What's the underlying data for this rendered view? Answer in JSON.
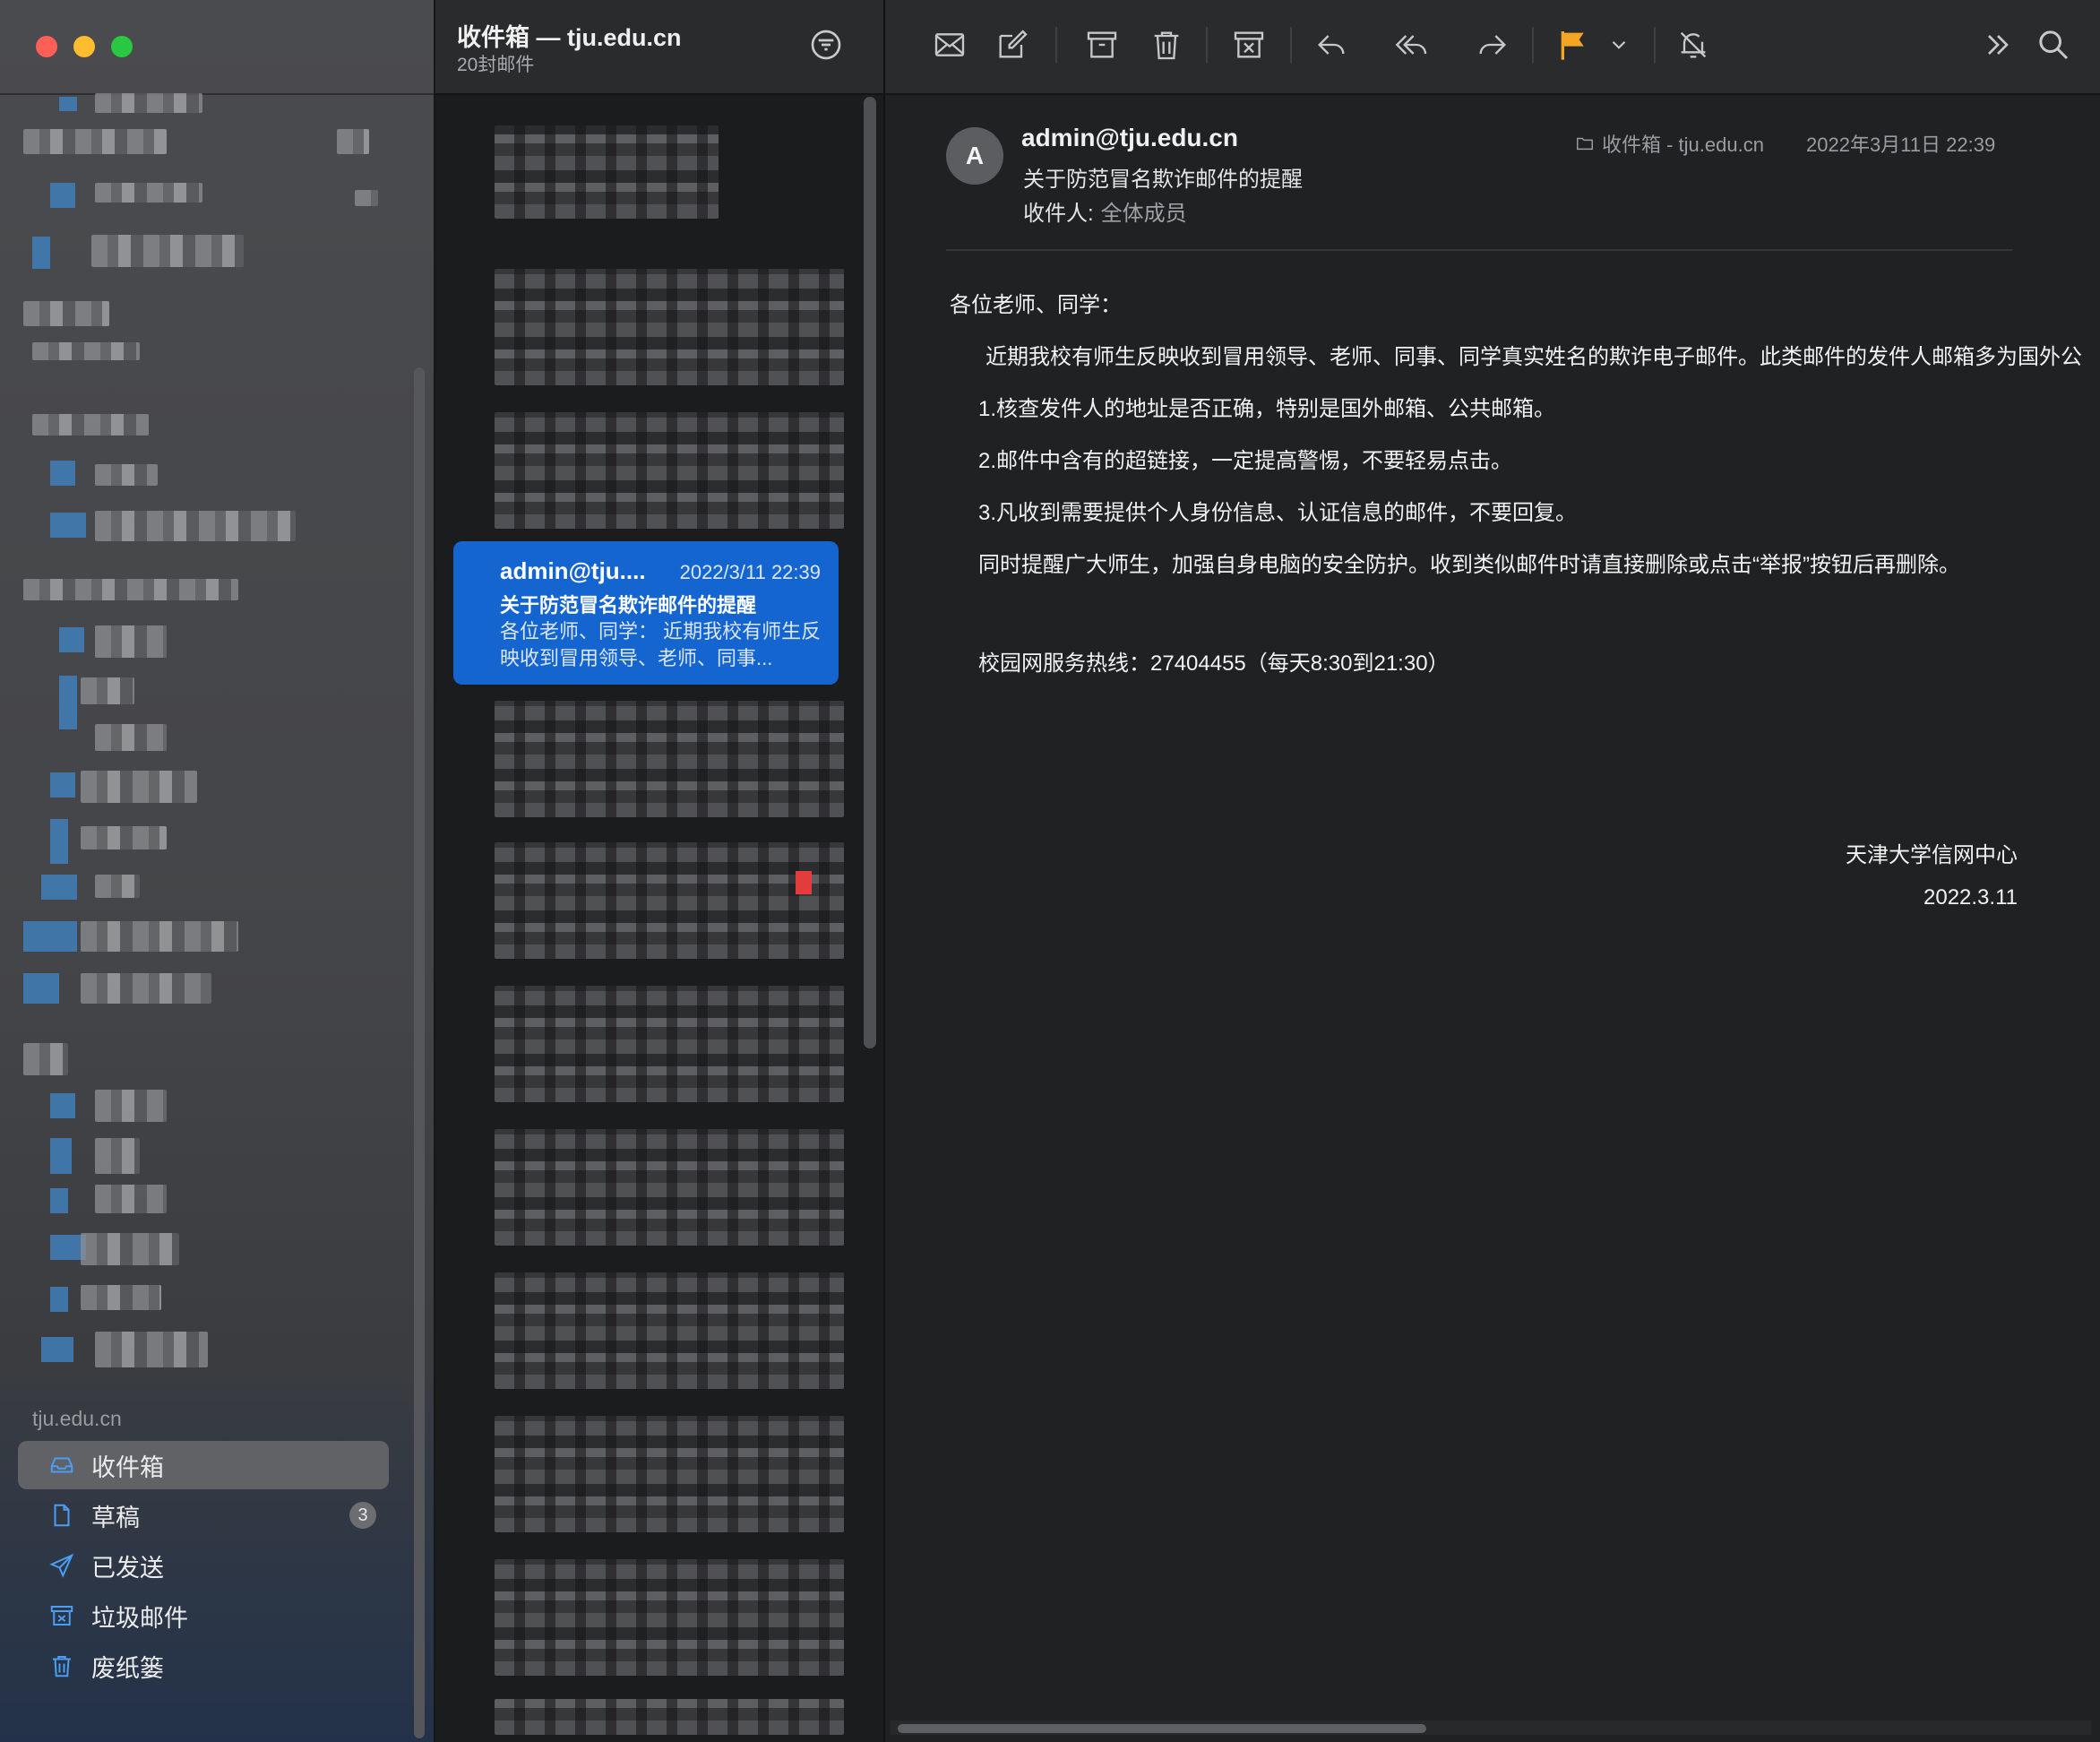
{
  "window": {
    "traffic_lights": [
      "close",
      "minimize",
      "maximize"
    ]
  },
  "sidebar": {
    "account": "tju.edu.cn",
    "items": [
      {
        "label": "收件箱",
        "icon": "inbox-icon",
        "active": true
      },
      {
        "label": "草稿",
        "icon": "draft-icon",
        "badge": "3"
      },
      {
        "label": "已发送",
        "icon": "sent-icon"
      },
      {
        "label": "垃圾邮件",
        "icon": "junk-icon"
      },
      {
        "label": "废纸篓",
        "icon": "trash-icon"
      }
    ]
  },
  "message_list": {
    "title": "收件箱 — tju.edu.cn",
    "subtitle": "20封邮件",
    "selected": {
      "from": "admin@tju....",
      "date": "2022/3/11 22:39",
      "subject": "关于防范冒名欺诈邮件的提醒",
      "preview": "各位老师、同学：  近期我校有师生反映收到冒用领导、老师、同事..."
    }
  },
  "toolbar": {
    "buttons": [
      "envelope-icon",
      "compose-icon",
      "archive-icon",
      "trash-icon",
      "junk-icon",
      "reply-icon",
      "reply-all-icon",
      "forward-icon",
      "flag-icon",
      "chevron-down-icon",
      "mute-bell-icon",
      "more-chevrons-icon",
      "search-icon"
    ],
    "flag_color": "#f5a524"
  },
  "reader": {
    "avatar_initial": "A",
    "from": "admin@tju.edu.cn",
    "subject": "关于防范冒名欺诈邮件的提醒",
    "to_label": "收件人:",
    "to_value": "全体成员",
    "mailbox": "收件箱 - tju.edu.cn",
    "date": "2022年3月11日 22:39",
    "body": {
      "greeting": "各位老师、同学：",
      "para1": "近期我校有师生反映收到冒用领导、老师、同事、同学真实姓名的欺诈电子邮件。此类邮件的发件人邮箱多为国外公",
      "item1": "1.核查发件人的地址是否正确，特别是国外邮箱、公共邮箱。",
      "item2": "2.邮件中含有的超链接，一定提高警惕，不要轻易点击。",
      "item3": "3.凡收到需要提供个人身份信息、认证信息的邮件，不要回复。",
      "reminder": "同时提醒广大师生，加强自身电脑的安全防护。收到类似邮件时请直接删除或点击“举报”按钮后再删除。",
      "hotline": "校园网服务热线：27404455（每天8:30到21:30）",
      "signature": "天津大学信网中心",
      "sign_date": "2022.3.11"
    }
  },
  "colors": {
    "accent": "#1565d0",
    "sidebar_icon": "#4a9ef5",
    "close": "#ff5f57",
    "minimize": "#febc2e",
    "maximize": "#28c840"
  }
}
